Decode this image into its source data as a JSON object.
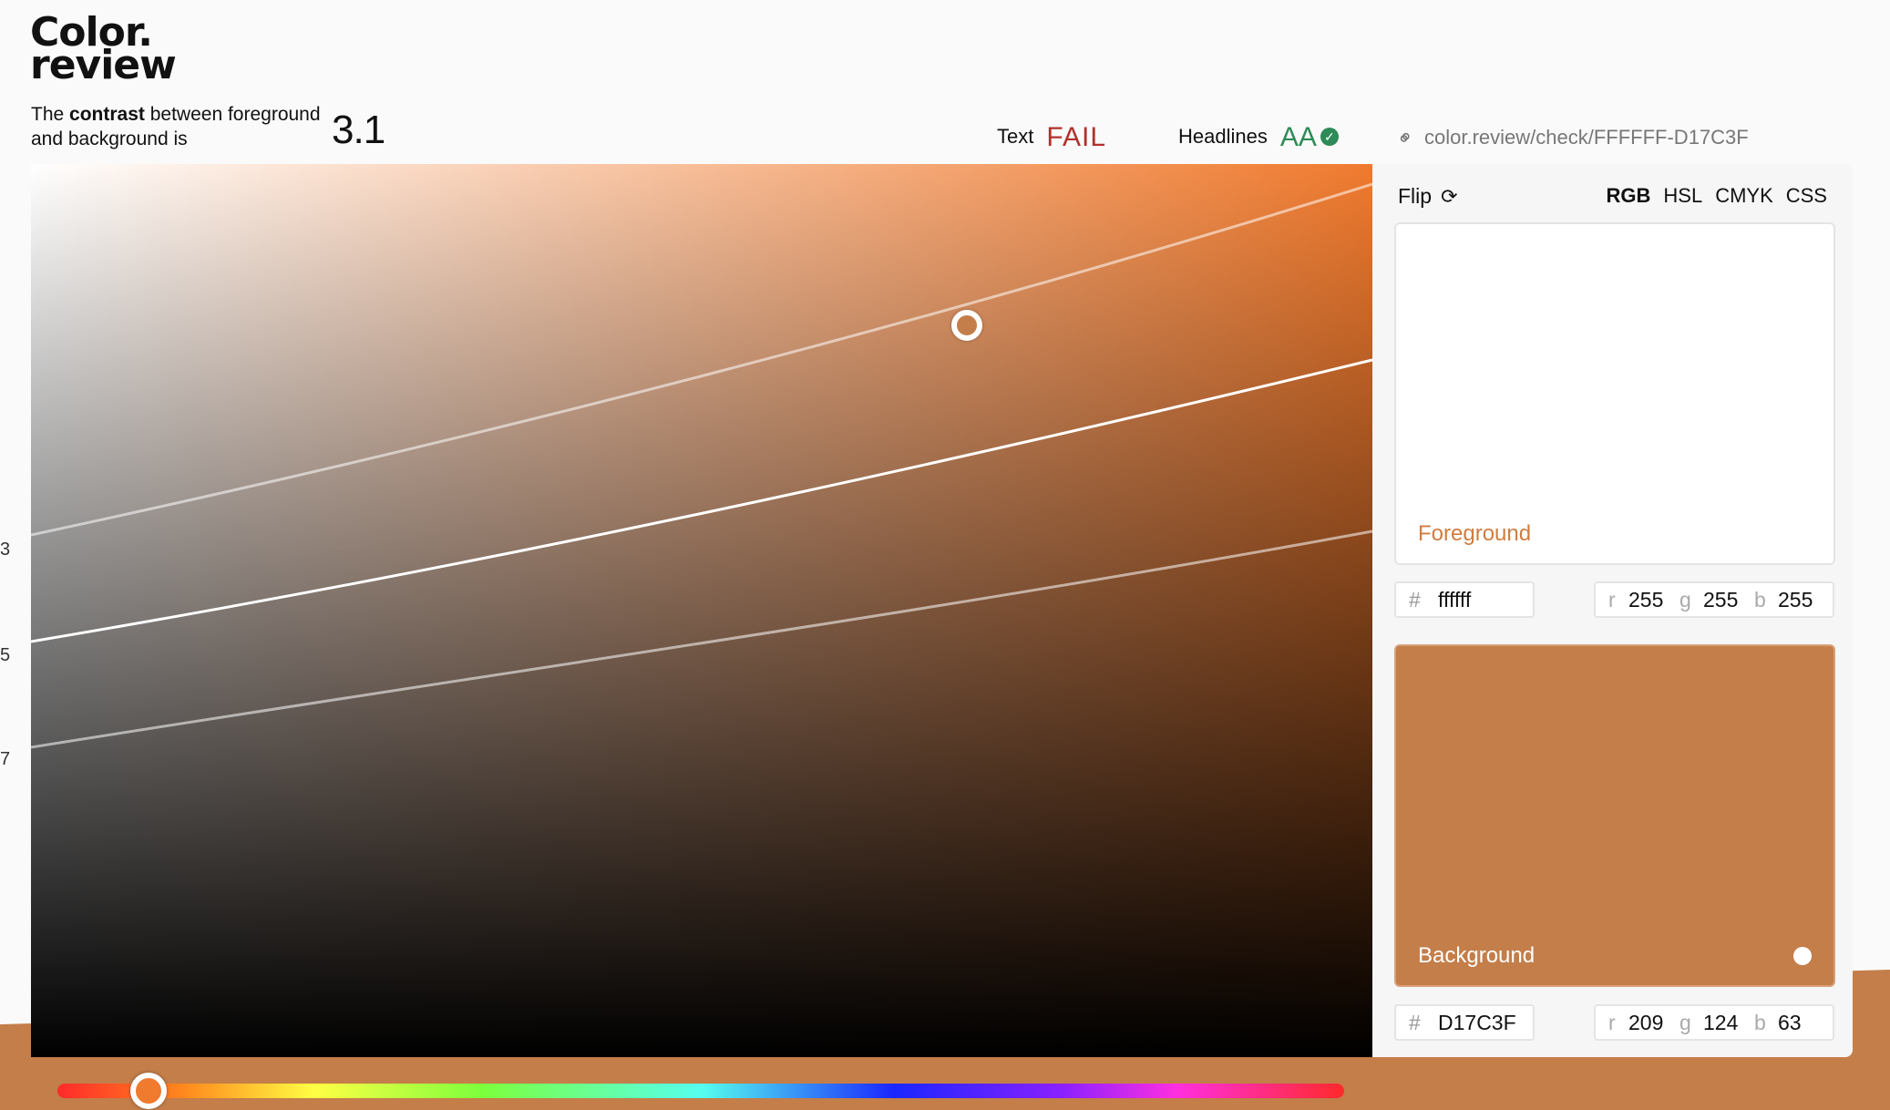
{
  "logo": {
    "line1": "Color",
    "dot": ".",
    "line2": "review"
  },
  "intro": {
    "prefix": "The ",
    "bold": "contrast",
    "suffix": " between foreground and background is"
  },
  "ratio": "3.1",
  "status": {
    "text_label": "Text",
    "text_value": "FAIL",
    "headlines_label": "Headlines",
    "headlines_value": "AA",
    "text_color": "#b0312c",
    "headlines_color": "#2e8b57"
  },
  "url": {
    "icon": "link-icon",
    "text": "color.review/check/FFFFFF-D17C3F"
  },
  "side_numbers": [
    "3",
    "5",
    "7"
  ],
  "panel": {
    "flip_label": "Flip",
    "flip_icon": "refresh-icon",
    "modes": [
      "RGB",
      "HSL",
      "CMYK",
      "CSS"
    ],
    "active_mode": "RGB",
    "foreground": {
      "label": "Foreground",
      "color": "#ffffff",
      "hash": "#",
      "hex": "ffffff",
      "r_label": "r",
      "r": "255",
      "g_label": "g",
      "g": "255",
      "b_label": "b",
      "b": "255"
    },
    "background": {
      "label": "Background",
      "color": "#c47e4a",
      "hash": "#",
      "hex": "D17C3F",
      "r_label": "r",
      "r": "209",
      "g_label": "g",
      "g": "124",
      "b_label": "b",
      "b": "63"
    }
  },
  "hue_slider": {
    "value": 0.07
  }
}
